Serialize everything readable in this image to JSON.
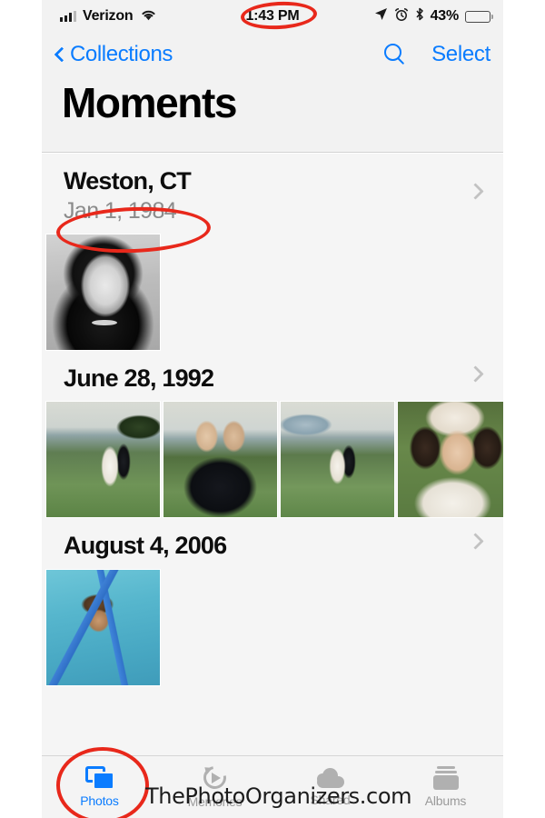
{
  "status_bar": {
    "carrier": "Verizon",
    "signal_bars_filled": 3,
    "signal_bars_total": 4,
    "wifi_icon": "wifi-icon",
    "time": "1:43 PM",
    "location_icon": "location-arrow-icon",
    "alarm_icon": "alarm-clock-icon",
    "bluetooth_icon": "bluetooth-icon",
    "battery_percent": "43%",
    "battery_level": 43
  },
  "nav_bar": {
    "back_label": "Collections",
    "back_icon": "chevron-left-icon",
    "search_icon": "search-icon",
    "select_label": "Select",
    "title": "Moments"
  },
  "moments": [
    {
      "title": "Weston, CT",
      "subtitle": "Jan 1, 1984",
      "disclosure_icon": "chevron-right-icon",
      "photos": [
        {
          "name": "photo-portrait-bw",
          "style": "ph-portrait"
        }
      ]
    },
    {
      "title": "June 28, 1992",
      "subtitle": "",
      "disclosure_icon": "chevron-right-icon",
      "photos": [
        {
          "name": "photo-wedding-couple-lawn",
          "style": "ph-wed1"
        },
        {
          "name": "photo-two-men-tuxedos",
          "style": "ph-wed2"
        },
        {
          "name": "photo-couple-kissing-lawn",
          "style": "ph-wed3"
        },
        {
          "name": "photo-bride-closeup",
          "style": "ph-bride"
        }
      ]
    },
    {
      "title": "August 4, 2006",
      "subtitle": "",
      "disclosure_icon": "chevron-right-icon",
      "photos": [
        {
          "name": "photo-child-in-pool",
          "style": "ph-pool"
        }
      ]
    }
  ],
  "tab_bar": {
    "tabs": [
      {
        "label": "Photos",
        "icon": "photos-icon",
        "active": true
      },
      {
        "label": "Memories",
        "icon": "memories-icon",
        "active": false
      },
      {
        "label": "Shared",
        "icon": "shared-cloud-icon",
        "active": false
      },
      {
        "label": "Albums",
        "icon": "albums-icon",
        "active": false
      }
    ]
  },
  "annotations": {
    "color": "#e8281b",
    "circled_time": "1:43 PM",
    "circled_date": "Jan 1, 1984",
    "circled_tab": "Photos"
  },
  "watermark": {
    "text": "ThePhotoOrganizers.com"
  },
  "colors": {
    "accent_blue": "#0a7cff",
    "annotation_red": "#e8281b",
    "content_bg": "#f5f5f5",
    "chrome_bg": "#f2f2f2"
  }
}
